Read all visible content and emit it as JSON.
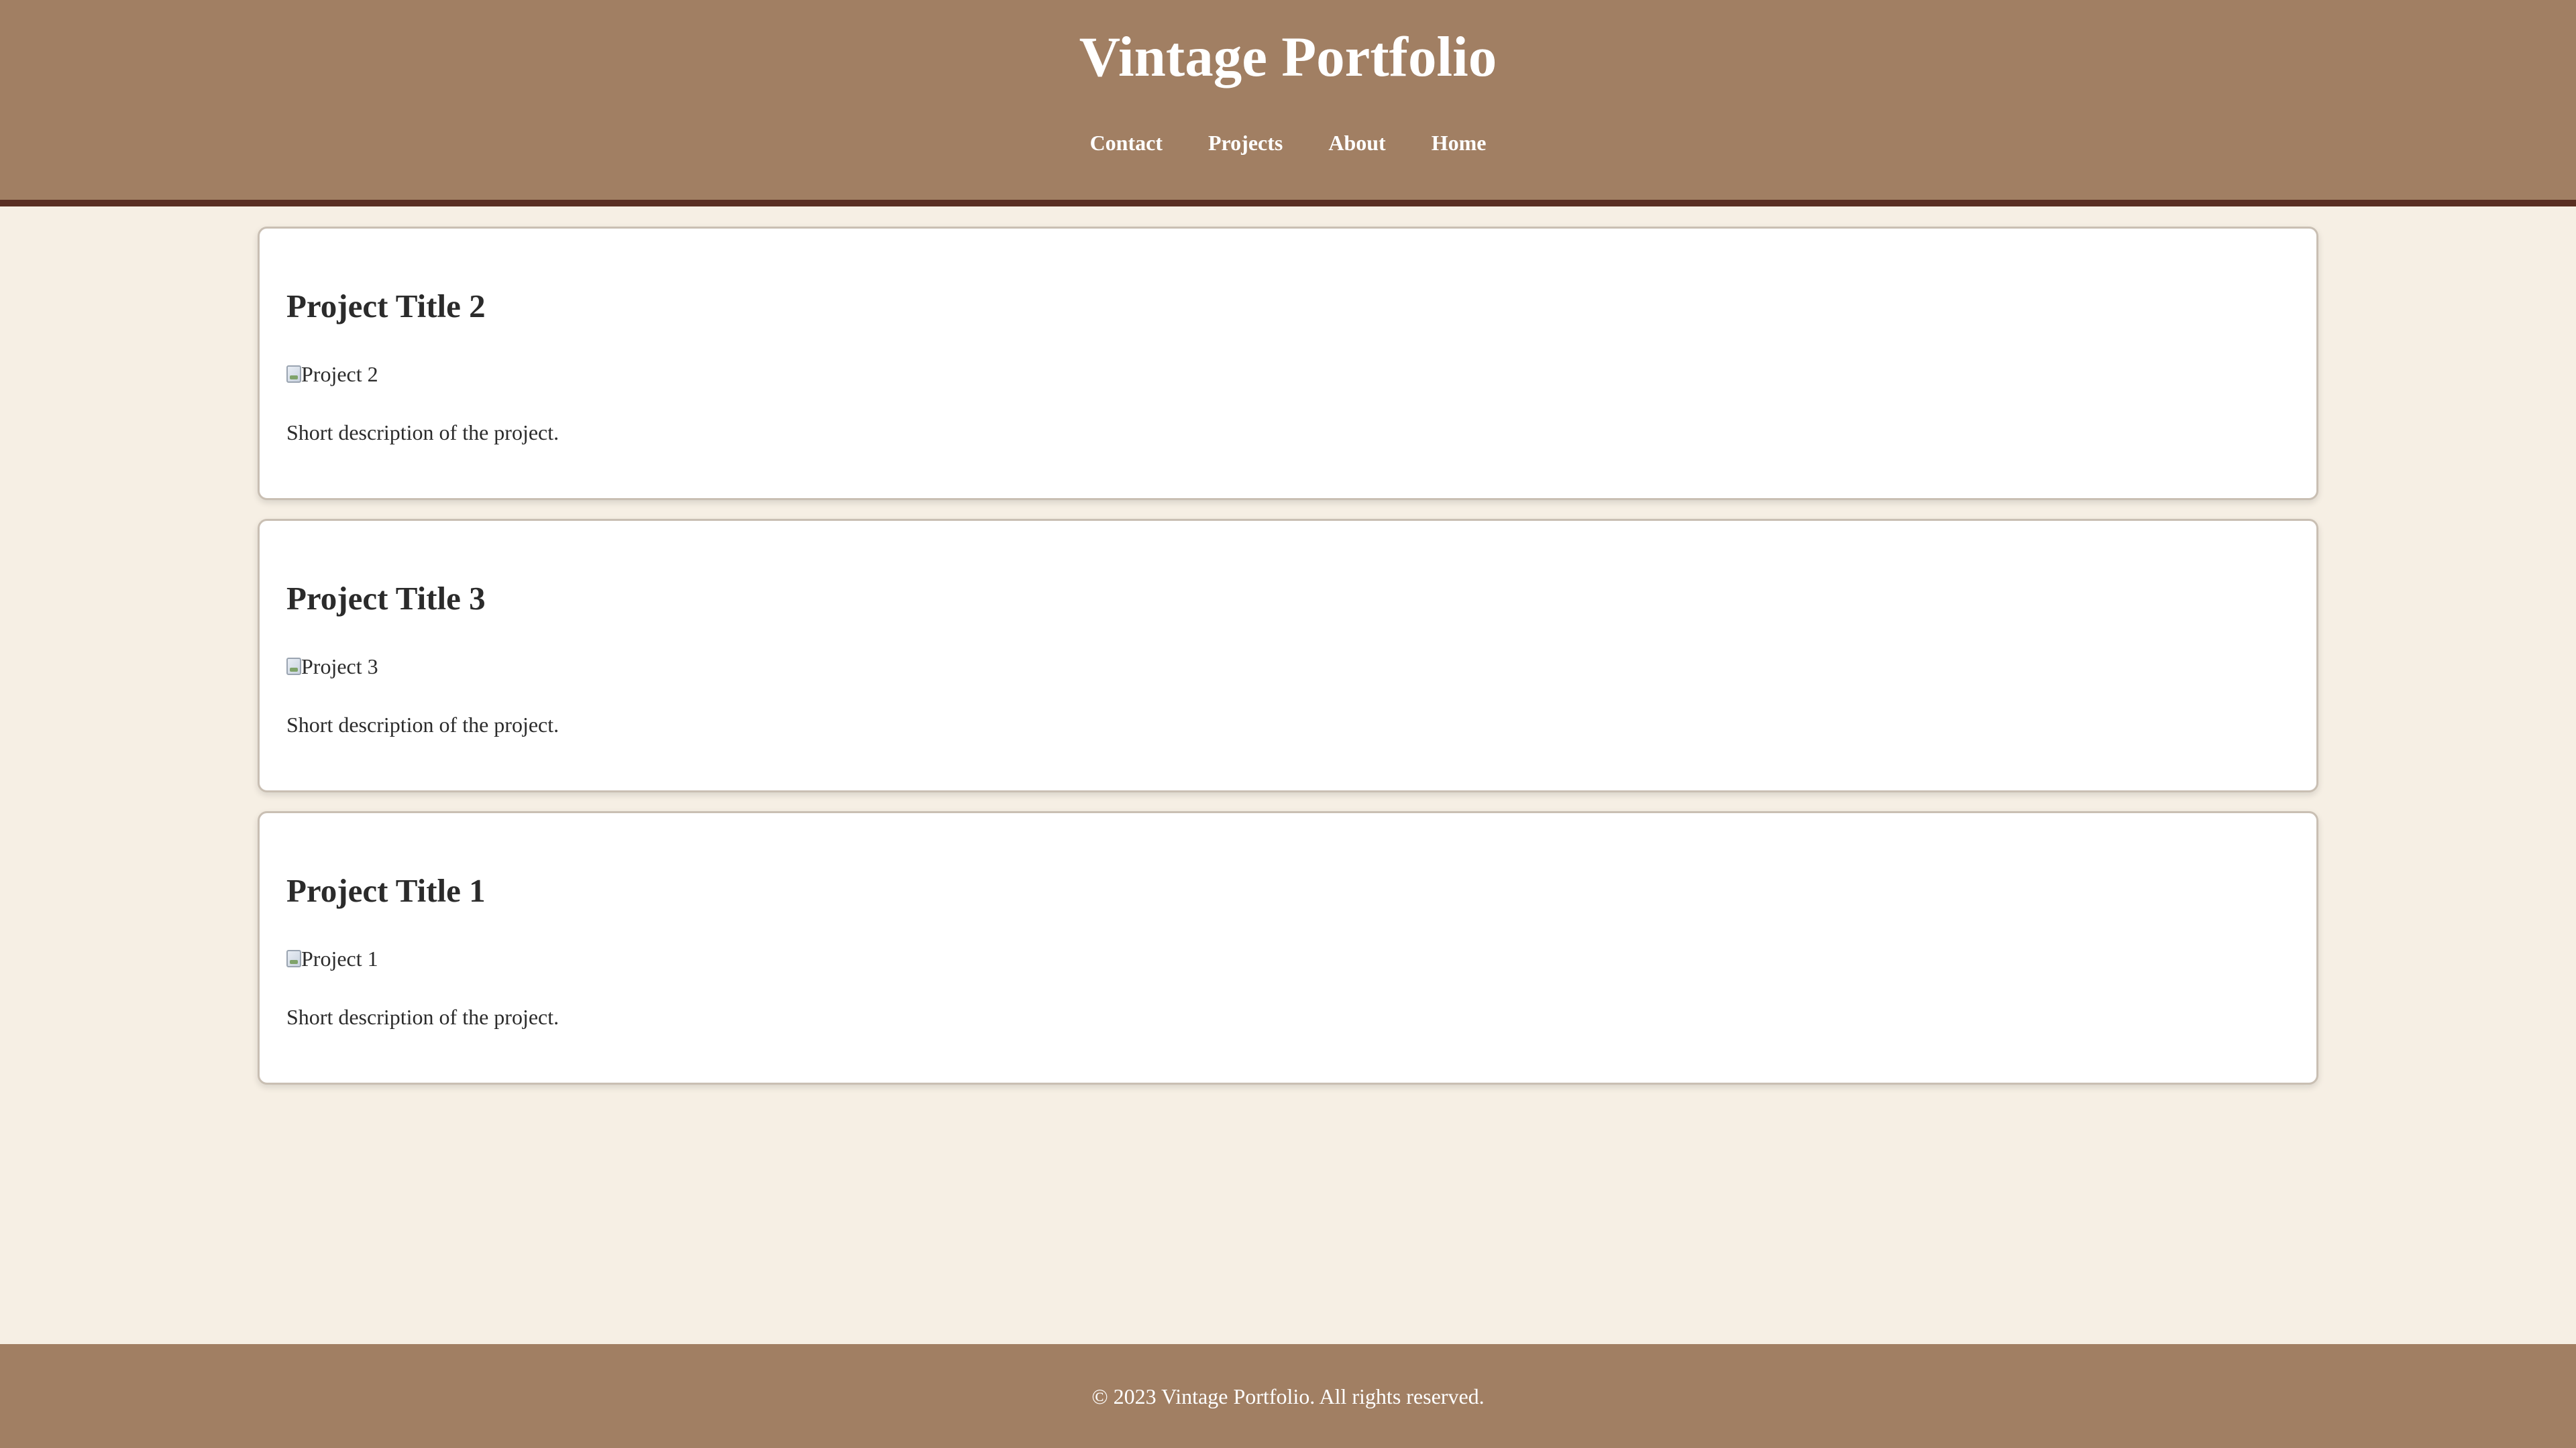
{
  "header": {
    "title": "Vintage Portfolio",
    "nav": [
      {
        "label": "Contact"
      },
      {
        "label": "Projects"
      },
      {
        "label": "About"
      },
      {
        "label": "Home"
      }
    ]
  },
  "projects": [
    {
      "title": "Project Title 2",
      "image_alt": "Project 2",
      "description": "Short description of the project."
    },
    {
      "title": "Project Title 3",
      "image_alt": "Project 3",
      "description": "Short description of the project."
    },
    {
      "title": "Project Title 1",
      "image_alt": "Project 1",
      "description": "Short description of the project."
    }
  ],
  "footer": {
    "text": "© 2023 Vintage Portfolio. All rights reserved."
  },
  "colors": {
    "header_bg": "#a17f63",
    "header_border": "#5a2e22",
    "page_bg": "#f6efe4",
    "card_bg": "#ffffff",
    "text": "#2b2b2b"
  },
  "icons": {
    "project_image": "broken-image-icon"
  }
}
